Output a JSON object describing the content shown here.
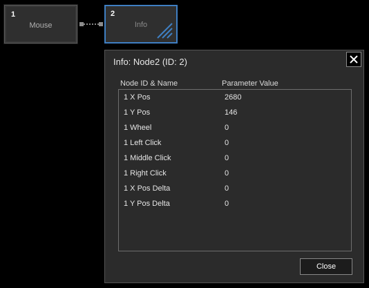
{
  "nodes": [
    {
      "number": "1",
      "label": "Mouse"
    },
    {
      "number": "2",
      "label": "Info"
    }
  ],
  "dialog": {
    "title": "Info: Node2 (ID: 2)",
    "columns": {
      "name": "Node ID & Name",
      "value": "Parameter Value"
    },
    "rows": [
      {
        "name": "1 X Pos",
        "value": "2680"
      },
      {
        "name": "1 Y Pos",
        "value": "146"
      },
      {
        "name": "1 Wheel",
        "value": "0"
      },
      {
        "name": "1 Left Click",
        "value": "0"
      },
      {
        "name": "1 Middle Click",
        "value": "0"
      },
      {
        "name": "1 Right Click",
        "value": "0"
      },
      {
        "name": "1 X Pos Delta",
        "value": "0"
      },
      {
        "name": "1 Y Pos Delta",
        "value": "0"
      }
    ],
    "close_label": "Close"
  },
  "colors": {
    "background": "#000000",
    "node_fill": "#2f2f2f",
    "selected_border": "#3f7fc3",
    "dialog_fill": "#2b2b2b"
  },
  "icons": {
    "dialog_close": "close-x-icon",
    "node_hatch": "hatch-icon"
  }
}
